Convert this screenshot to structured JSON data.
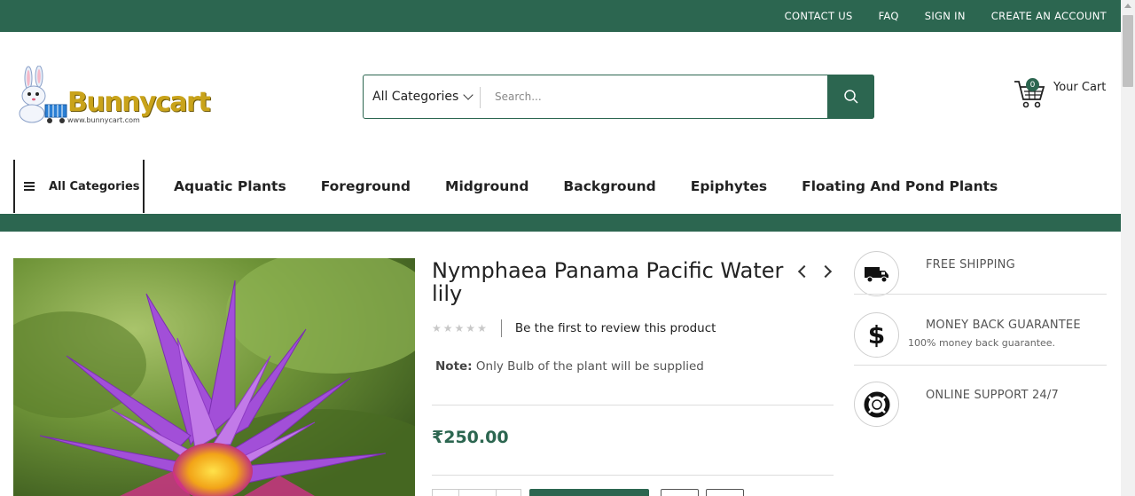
{
  "topbar": {
    "links": [
      "CONTACT US",
      "FAQ",
      "SIGN IN",
      "CREATE AN ACCOUNT"
    ]
  },
  "brand": {
    "logo_text": "Bunnycart",
    "logo_url_text": "www.bunnycart.com"
  },
  "search": {
    "category_label": "All Categories",
    "placeholder": "Search..."
  },
  "cart": {
    "count": "0",
    "label": "Your Cart"
  },
  "nav": {
    "all_categories": "All Categories",
    "items": [
      "Aquatic Plants",
      "Foreground",
      "Midground",
      "Background",
      "Epiphytes",
      "Floating And Pond Plants"
    ]
  },
  "product": {
    "title": "Nymphaea Panama Pacific Water lily",
    "rating_stars": 0,
    "review_link": "Be the first to review this product",
    "note_label": "Note:",
    "note_text": " Only Bulb of the plant will be supplied",
    "price": "₹250.00"
  },
  "features": [
    {
      "title": "FREE SHIPPING",
      "subtitle": "",
      "icon": "truck-icon"
    },
    {
      "title": "MONEY BACK GUARANTEE",
      "subtitle": "100% money back guarantee.",
      "icon": "dollar-icon"
    },
    {
      "title": "ONLINE SUPPORT 24/7",
      "subtitle": "",
      "icon": "lifebuoy-icon"
    }
  ],
  "colors": {
    "brand_green": "#2c6650",
    "logo_gold": "#c9a31a"
  }
}
